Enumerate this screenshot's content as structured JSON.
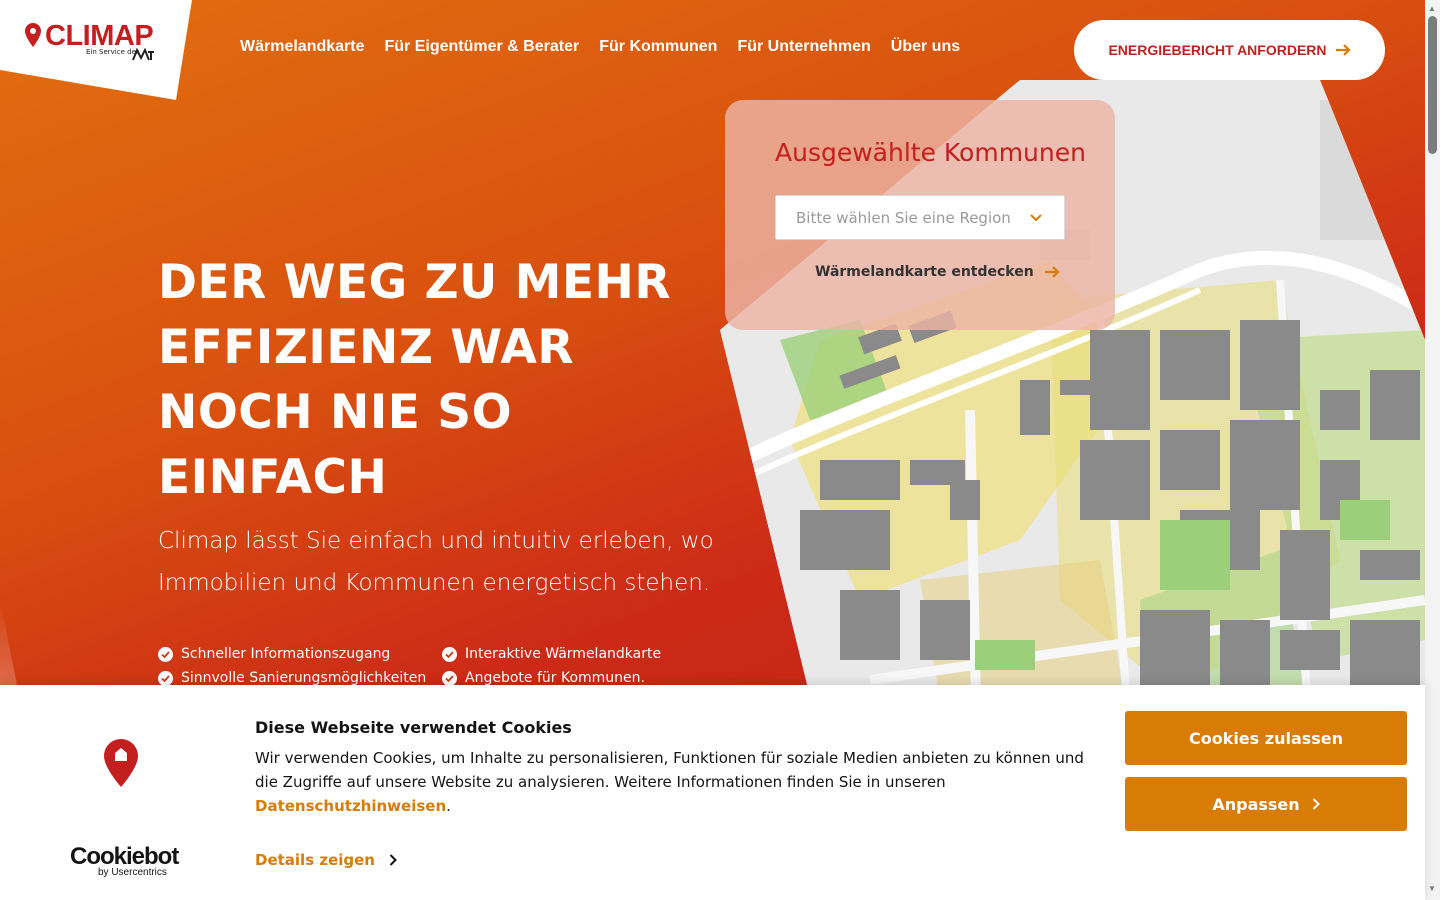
{
  "header": {
    "logo_text": "CLIMAP",
    "logo_sub": "Ein Service der",
    "nav": [
      "Wärmelandkarte",
      "Für Eigentümer & Berater",
      "Für Kommunen",
      "Für Unternehmen",
      "Über uns"
    ],
    "cta_label": "ENERGIEBERICHT ANFORDERN"
  },
  "hero": {
    "headline_lines": [
      "DER WEG ZU MEHR",
      "EFFIZIENZ WAR",
      "NOCH NIE SO",
      "EINFACH"
    ],
    "subtitle": "Climap lässt Sie einfach und intuitiv erleben, wo Immobilien und Kommunen energetisch stehen.",
    "features": [
      "Schneller Informationszugang",
      "Interaktive Wärmelandkarte",
      "Sinnvolle Sanierungsmöglichkeiten",
      "Angebote für Kommunen."
    ]
  },
  "map_overlay": {
    "title": "Ausgewählte Kommunen",
    "select_placeholder": "Bitte wählen Sie eine Region",
    "discover_link": "Wärmelandkarte entdecken"
  },
  "cookie": {
    "title": "Diese Webseite verwendet Cookies",
    "text": "Wir verwenden Cookies, um Inhalte zu personalisieren, Funktionen für soziale Medien anbieten zu können und die Zugriffe auf unsere Website zu analysieren. Weitere Informationen finden Sie in unseren",
    "privacy_link": "Datenschutzhinweisen",
    "details_label": "Details zeigen",
    "allow_label": "Cookies zulassen",
    "customize_label": "Anpassen",
    "brand": "Cookiebot",
    "brand_sub": "by Usercentrics"
  },
  "colors": {
    "brand_red": "#c41f1f",
    "accent_orange": "#d97c06",
    "hero_start": "#e26f10",
    "hero_end": "#c22118"
  },
  "icons": [
    "map-pin-icon",
    "arrow-right-icon",
    "chevron-down-icon",
    "check-circle-icon",
    "chevron-right-icon"
  ]
}
